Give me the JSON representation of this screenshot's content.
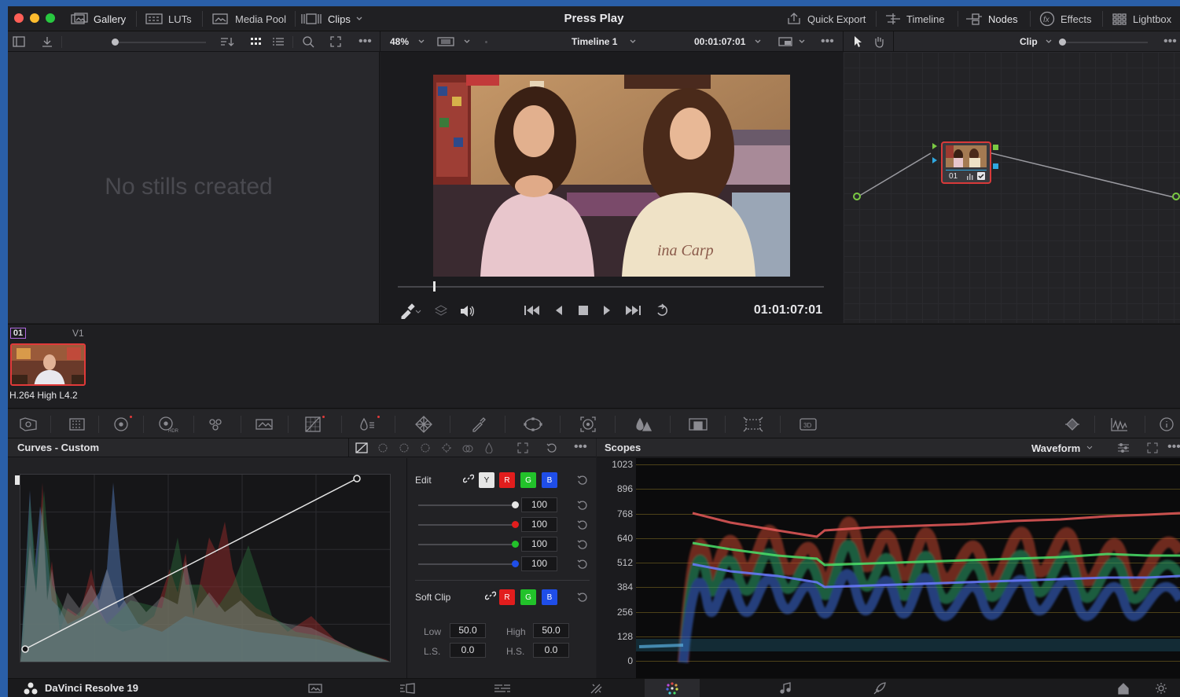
{
  "titlebar": {
    "app_title": "Press Play",
    "left_items": [
      {
        "label": "Gallery",
        "icon": "gallery-icon"
      },
      {
        "label": "LUTs",
        "icon": "luts-icon"
      },
      {
        "label": "Media Pool",
        "icon": "media-pool-icon"
      },
      {
        "label": "Clips",
        "icon": "clips-icon"
      }
    ],
    "right_items": [
      {
        "label": "Quick Export",
        "icon": "quick-export-icon"
      },
      {
        "label": "Timeline",
        "icon": "timeline-icon"
      },
      {
        "label": "Nodes",
        "icon": "nodes-icon"
      },
      {
        "label": "Effects",
        "icon": "effects-icon"
      },
      {
        "label": "Lightbox",
        "icon": "lightbox-icon"
      }
    ]
  },
  "viewer": {
    "zoom": "48%",
    "timeline_name": "Timeline 1",
    "timecode_top": "00:01:07:01",
    "timecode_bottom": "01:01:07:01",
    "playhead_fraction": 0.085
  },
  "gallery": {
    "empty_text": "No stills created"
  },
  "node_editor": {
    "mode": "Clip",
    "node_label": "01"
  },
  "clip_strip": {
    "clip_number": "01",
    "track": "V1",
    "codec": "H.264 High L4.2"
  },
  "curves": {
    "title": "Curves - Custom",
    "edit_label": "Edit",
    "channels": [
      "Y",
      "R",
      "G",
      "B"
    ],
    "intensity": [
      {
        "channel": "Y",
        "value": "100",
        "color": "#e6e6e6"
      },
      {
        "channel": "R",
        "value": "100",
        "color": "#e21d1d"
      },
      {
        "channel": "G",
        "value": "100",
        "color": "#22c22a"
      },
      {
        "channel": "B",
        "value": "100",
        "color": "#1f4ee8"
      }
    ],
    "soft_clip_label": "Soft Clip",
    "soft_clip": {
      "low_label": "Low",
      "low": "50.0",
      "high_label": "High",
      "high": "50.0",
      "ls_label": "L.S.",
      "ls": "0.0",
      "hs_label": "H.S.",
      "hs": "0.0"
    }
  },
  "scopes": {
    "title": "Scopes",
    "mode": "Waveform",
    "y_ticks": [
      "1023",
      "896",
      "768",
      "640",
      "512",
      "384",
      "256",
      "128",
      "0"
    ]
  },
  "bottombar": {
    "app_name": "DaVinci Resolve 19"
  },
  "colors": {
    "accent_red": "#e13a3a",
    "traffic_red": "#ff5f57",
    "traffic_yellow": "#febc2e",
    "traffic_green": "#28c840",
    "node_outline": "#d83a3a"
  }
}
